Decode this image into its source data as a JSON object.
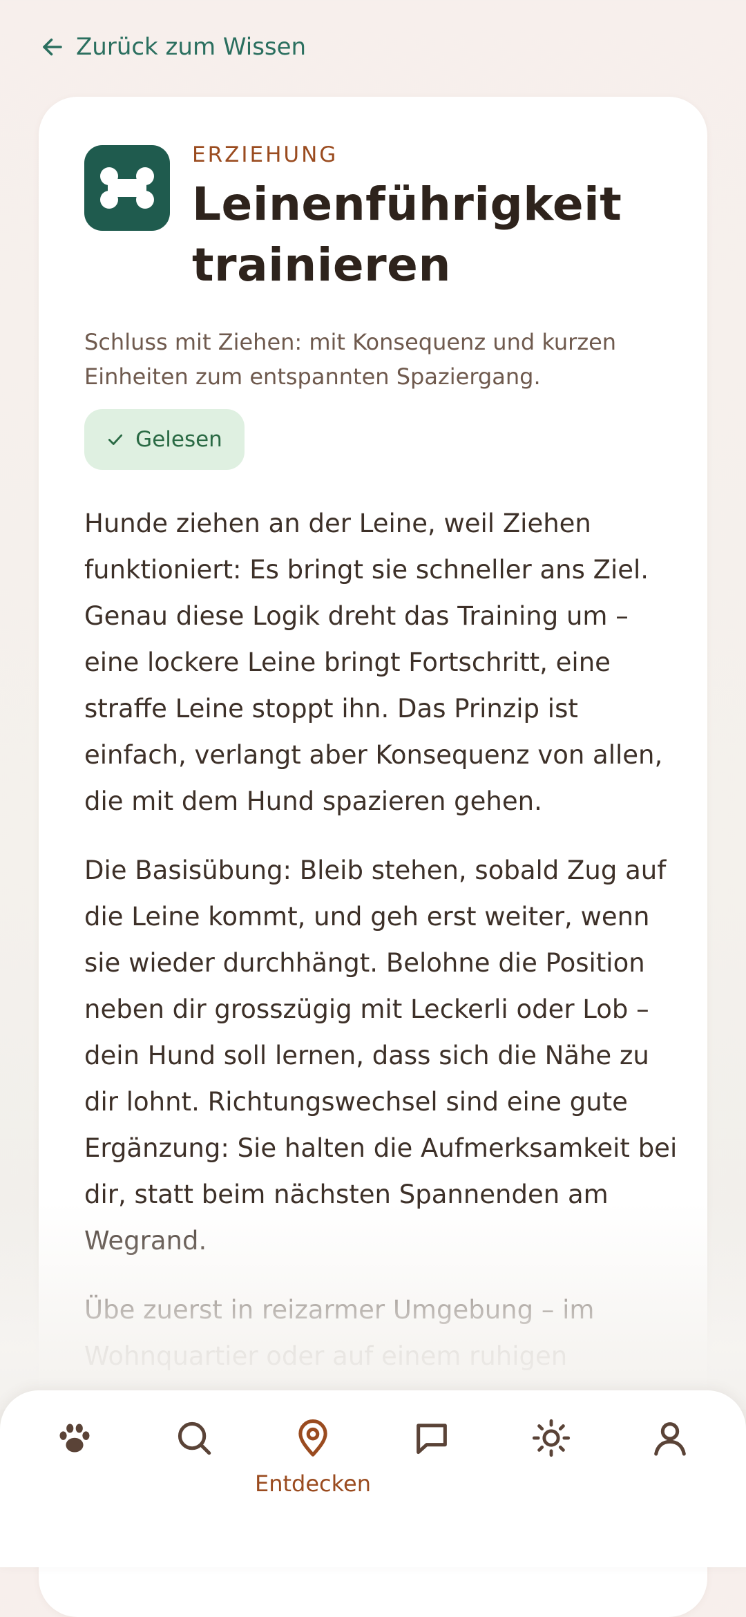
{
  "back_link": {
    "label": "Zurück zum Wissen",
    "icon": "arrow-left-icon"
  },
  "article": {
    "category": "ERZIEHUNG",
    "title": "Leinenführigkeit trainieren",
    "icon": "bone-icon",
    "subtitle": "Schluss mit Ziehen: mit Konsequenz und kurzen Einheiten zum entspannten Spaziergang.",
    "status_badge": {
      "label": "Gelesen",
      "icon": "check-icon"
    },
    "paragraphs": [
      "Hunde ziehen an der Leine, weil Ziehen funktioniert: Es bringt sie schneller ans Ziel. Genau diese Logik dreht das Training um – eine lockere Leine bringt Fortschritt, eine straffe Leine stoppt ihn. Das Prinzip ist einfach, verlangt aber Konsequenz von allen, die mit dem Hund spazieren gehen.",
      "Die Basisübung: Bleib stehen, sobald Zug auf die Leine kommt, und geh erst weiter, wenn sie wieder durchhängt. Belohne die Position neben dir grosszügig mit Leckerli oder Lob – dein Hund soll lernen, dass sich die Nähe zu dir lohnt. Richtungswechsel sind eine gute Ergänzung: Sie halten die Aufmerksamkeit bei dir, statt beim nächsten Spannenden am Wegrand.",
      "Übe zuerst in reizarmer Umgebung – im Wohnquartier oder auf einem ruhigen"
    ]
  },
  "bottom_nav": {
    "active": "discover",
    "items": [
      {
        "id": "home",
        "icon": "paw-icon",
        "label": ""
      },
      {
        "id": "search",
        "icon": "search-icon",
        "label": ""
      },
      {
        "id": "discover",
        "icon": "map-pin-icon",
        "label": "Entdecken"
      },
      {
        "id": "chat",
        "icon": "chat-bubble-icon",
        "label": ""
      },
      {
        "id": "weather",
        "icon": "sun-icon",
        "label": ""
      },
      {
        "id": "profile",
        "icon": "user-icon",
        "label": ""
      }
    ]
  },
  "colors": {
    "accent_green": "#1f5b4e",
    "link_green": "#2b6f5f",
    "accent_brown": "#9a4b1f",
    "text_dark": "#2e231c",
    "badge_bg": "#dff0e1",
    "nav_icon": "#5a4337"
  }
}
